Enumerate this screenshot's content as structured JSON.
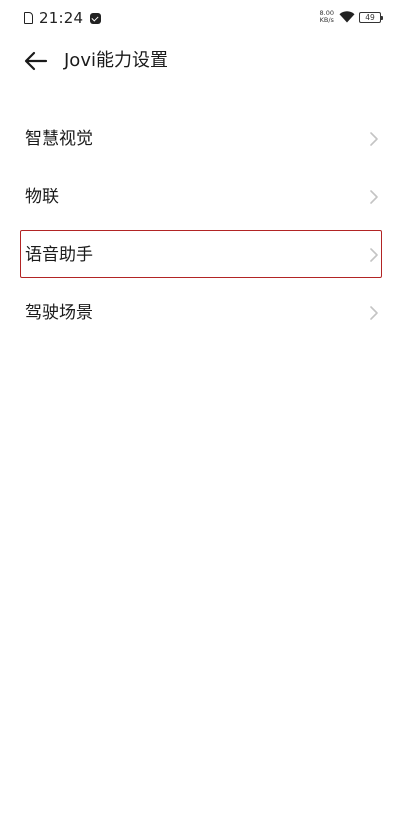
{
  "status_bar": {
    "time": "21:24",
    "net_speed_value": "8.00",
    "net_speed_unit": "KB/s",
    "battery_level": "49"
  },
  "header": {
    "title": "Jovi能力设置"
  },
  "settings_list": {
    "items": [
      {
        "label": "智慧视觉",
        "highlighted": false
      },
      {
        "label": "物联",
        "highlighted": false
      },
      {
        "label": "语音助手",
        "highlighted": true
      },
      {
        "label": "驾驶场景",
        "highlighted": false
      }
    ]
  },
  "colors": {
    "highlight_border": "#b22424",
    "chevron": "#c4c4c4"
  }
}
